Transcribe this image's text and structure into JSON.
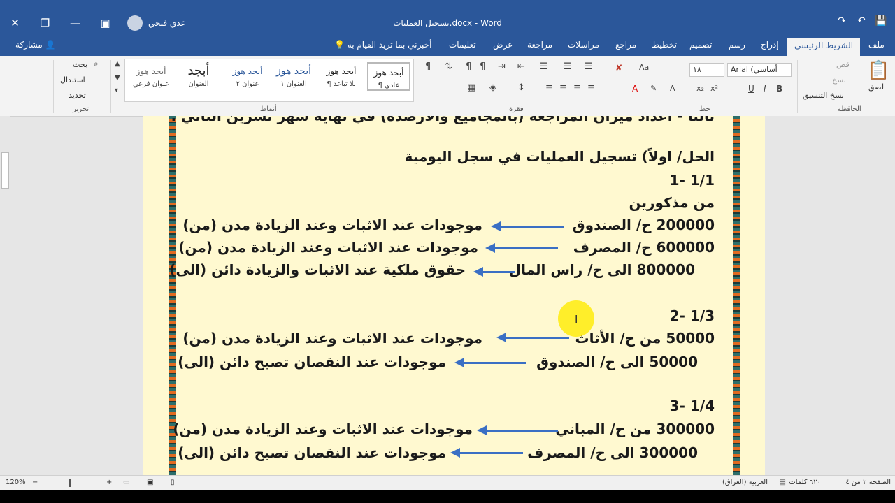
{
  "window": {
    "title": "تسجيل العمليات.docx - Word",
    "user_name": "عدي فتحي",
    "controls": {
      "close": "✕",
      "restore": "❐",
      "minimize": "—",
      "ribbon_display": "▣"
    }
  },
  "quick_access": {
    "save": "💾",
    "undo": "↶",
    "redo": "↷"
  },
  "tabs": {
    "file": "ملف",
    "home": "الشريط الرئيسي",
    "insert": "إدراج",
    "draw": "رسم",
    "design": "تصميم",
    "layout": "تخطيط",
    "references": "مراجع",
    "mailings": "مراسلات",
    "review": "مراجعة",
    "view": "عرض",
    "help": "تعليمات",
    "tell_me": "أخبرني بما تريد القيام به",
    "share": "مشاركة"
  },
  "ribbon": {
    "clipboard": {
      "label": "الحافظة",
      "paste": "لصق",
      "cut": "قص",
      "copy": "نسخ",
      "format_painter": "نسخ التنسيق"
    },
    "font": {
      "label": "خط",
      "font_name": "Arial (أساسي",
      "font_size": "١٨",
      "bold": "B",
      "italic": "I",
      "underline": "U"
    },
    "paragraph": {
      "label": "فقرة"
    },
    "styles": {
      "label": "أنماط",
      "items": [
        {
          "preview": "أبجد هوز",
          "name": "¶ عادي"
        },
        {
          "preview": "أبجد هوز",
          "name": "¶ بلا تباعد"
        },
        {
          "preview": "أبجد هوز",
          "name": "العنوان ١"
        },
        {
          "preview": "أبجد هوز",
          "name": "عنوان ٢"
        },
        {
          "preview": "أبجد",
          "name": "العنوان"
        },
        {
          "preview": "أبجد هوز",
          "name": "عنوان فرعي"
        }
      ]
    },
    "editing": {
      "label": "تحرير",
      "find": "بحث",
      "replace": "استبدال",
      "select": "تحديد"
    }
  },
  "document": {
    "top_cut_line": "ثالثاً - اعداد ميزان المراجعة (بالمجاميع والارصدة) في نهاية شهر تشرين الثاني .",
    "heading": "الحل/ اولاً) تسجيل العمليات في سجل اليومية",
    "entry1_date": "1/1 -1",
    "entry1_from": "من مذكورين",
    "entry1_line1_amount": "200000 ح/ الصندوق",
    "entry1_line1_note": "موجودات عند الاثبات وعند الزيادة مدن (من)",
    "entry1_line2_amount": "600000 ح/ المصرف",
    "entry1_line2_note": "موجودات عند الاثبات وعند الزيادة مدن (من)",
    "entry1_line3_amount": "800000 الى ح/ راس المال",
    "entry1_line3_note": "حقوق ملكية عند الاثبات والزيادة دائن (الى)",
    "entry2_date": "1/3 -2",
    "entry2_line1_amount": "50000 من ح/ الأثاث",
    "entry2_line1_note": "موجودات عند الاثبات وعند الزيادة مدن (من)",
    "entry2_line2_amount": "50000 الى ح/ الصندوق",
    "entry2_line2_note": "موجودات عند النقصان تصبح دائن (الى)",
    "entry3_date": "1/4 -3",
    "entry3_line1_amount": "300000 من ح/ المباني",
    "entry3_line1_note": "موجودات عند الاثبات وعند الزيادة مدن (من)",
    "entry3_line2_amount": "300000 الى ح/ المصرف",
    "entry3_line2_note": "موجودات عند النقصان تصبح دائن (الى)"
  },
  "status": {
    "page": "الصفحة ٢ من ٤",
    "words": "٦٢٠ كلمات",
    "language": "العربية (العراق)",
    "zoom": "120%"
  },
  "colors": {
    "word_blue": "#2b579a",
    "arrow_blue": "#3a6fc4",
    "page_bg": "#fff9d0"
  }
}
